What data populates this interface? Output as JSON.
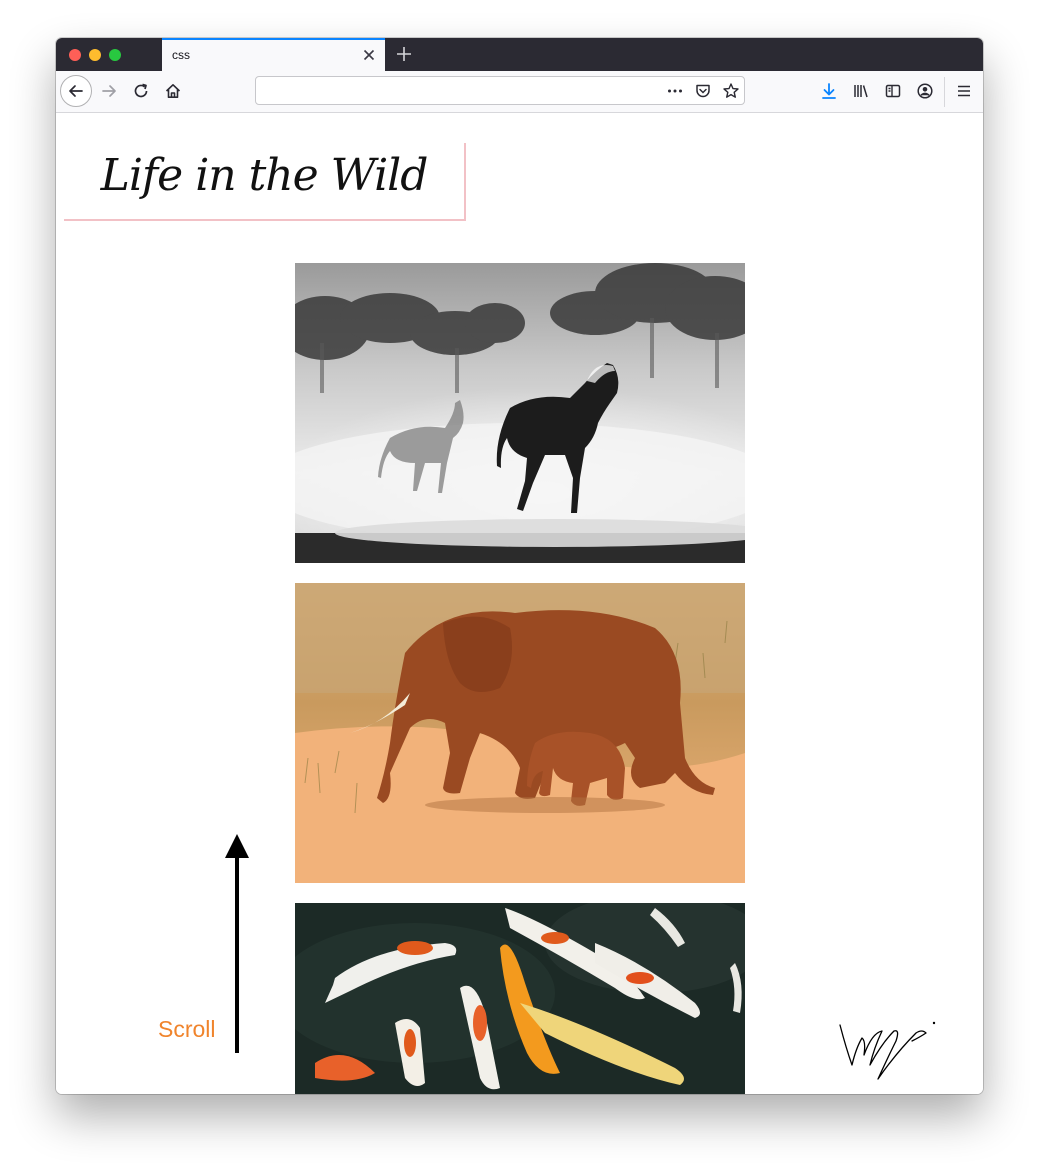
{
  "browser": {
    "tab_title": "css",
    "url": "",
    "url_placeholder": ""
  },
  "page": {
    "title": "Life in the Wild",
    "scroll_label": "Scroll"
  },
  "photos": [
    {
      "subject": "horses running in dust, black and white"
    },
    {
      "subject": "elephant with calf walking on red dirt road"
    },
    {
      "subject": "koi fish in dark water"
    }
  ],
  "icons": {
    "back": "arrow-left-icon",
    "forward": "arrow-right-icon",
    "reload": "reload-icon",
    "home": "home-icon",
    "page_actions": "more-icon",
    "pocket": "pocket-icon",
    "bookmark": "star-icon",
    "downloads": "download-icon",
    "library": "library-icon",
    "sidebar": "sidebar-icon",
    "account": "account-icon",
    "menu": "hamburger-menu-icon"
  },
  "colors": {
    "accent_tab": "#0a84ff",
    "download_icon": "#0a84ff",
    "scroll_label": "#f0842c",
    "title_border": "#f2c1c6"
  }
}
